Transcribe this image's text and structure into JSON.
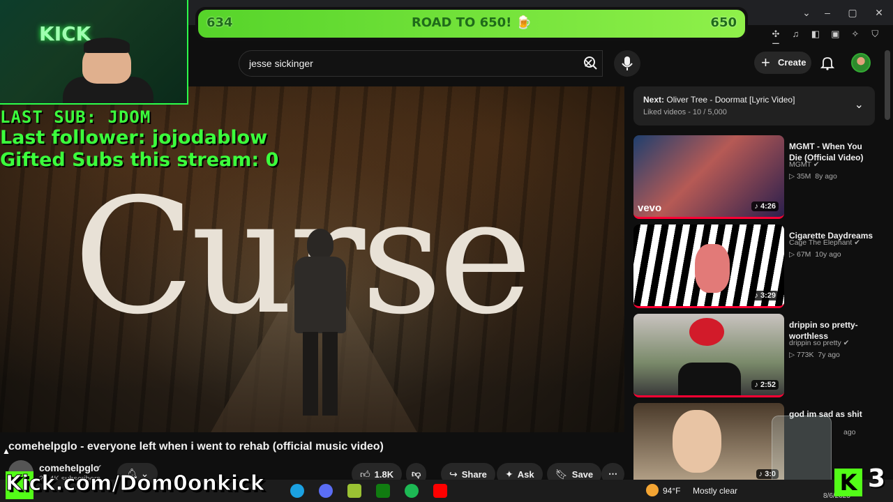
{
  "banner": {
    "start": "634",
    "label": "ROAD TO 650! 🍺",
    "end": "650"
  },
  "search": {
    "query": "jesse sickinger"
  },
  "header": {
    "create_label": "Create"
  },
  "stream_overlay": {
    "last_sub": "LAST SUB: JDOM",
    "last_follower": "Last follower: jojodablow",
    "gifted": "Gifted Subs this stream: 0",
    "kick_url": "Kick.com/Dom0onkick",
    "kick_count": "3"
  },
  "video": {
    "overlay_text": "Curse",
    "title": "comehelpglo - everyone left when i went to rehab (official music video)",
    "channel": "comehelpglo",
    "subscribers": "25.4K subscribers",
    "likes": "1.8K",
    "share_label": "Share",
    "ask_label": "Ask",
    "save_label": "Save"
  },
  "up_next": {
    "title_prefix": "Next:",
    "title": "Oliver Tree - Doormat [Lyric Video]",
    "subtitle": "Liked videos - 10 / 5,000"
  },
  "recommendations": [
    {
      "title": "MGMT - When You Die (Official Video)",
      "channel": "MGMT",
      "views": "35M",
      "age": "8y ago",
      "duration": "4:26"
    },
    {
      "title": "Cigarette Daydreams",
      "channel": "Cage The Elephant",
      "views": "67M",
      "age": "10y ago",
      "duration": "3:29"
    },
    {
      "title": "drippin so pretty- worthless",
      "channel": "drippin so pretty",
      "views": "773K",
      "age": "7y ago",
      "duration": "2:52"
    },
    {
      "title": "god im sad as shit",
      "channel": "",
      "views": "",
      "age": "ago",
      "duration": "3:0"
    }
  ],
  "taskbar": {
    "temp": "94°F",
    "condition": "Mostly clear",
    "date": "8/6/2025"
  },
  "colors": {
    "accent_red": "#ff0033",
    "kick_green": "#53fc18",
    "overlay_green": "#3cff3c"
  }
}
